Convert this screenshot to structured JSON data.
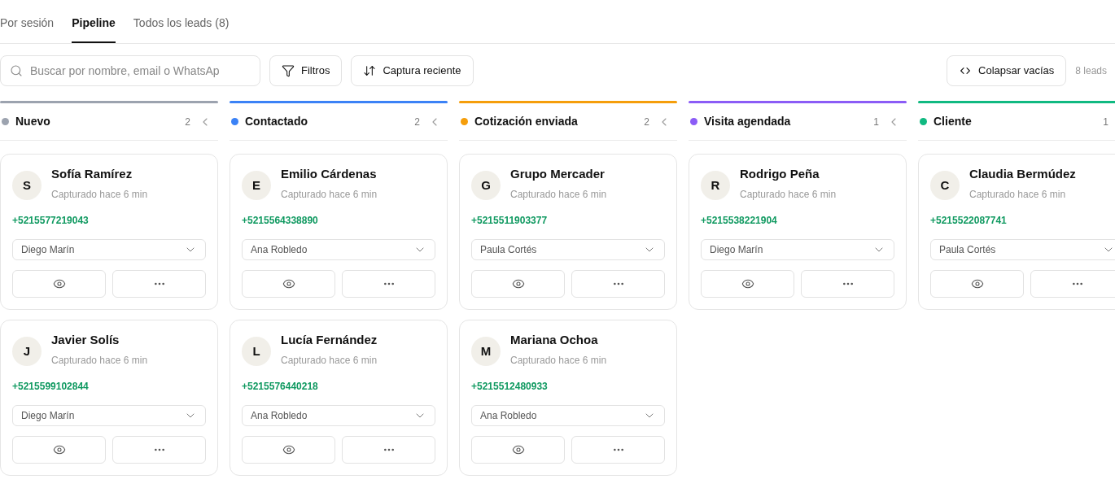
{
  "tabs": [
    {
      "label": "Por sesión",
      "selected": false
    },
    {
      "label": "Pipeline",
      "selected": true
    },
    {
      "label": "Todos los leads (8)",
      "selected": false
    }
  ],
  "search": {
    "placeholder": "Buscar por nombre, email o WhatsAp"
  },
  "toolbar": {
    "filters": "Filtros",
    "sort": "Captura reciente",
    "collapse": "Colapsar vacías",
    "total": "8 leads"
  },
  "columns": [
    {
      "name": "Nuevo",
      "color": "#9ca3af",
      "count": "2",
      "leads": [
        {
          "initial": "S",
          "name": "Sofía Ramírez",
          "captured": "Capturado hace 6 min",
          "phone": "+5215577219043",
          "agent": "Diego Marín"
        },
        {
          "initial": "J",
          "name": "Javier Solís",
          "captured": "Capturado hace 6 min",
          "phone": "+5215599102844",
          "agent": "Diego Marín"
        }
      ]
    },
    {
      "name": "Contactado",
      "color": "#3b82f6",
      "count": "2",
      "leads": [
        {
          "initial": "E",
          "name": "Emilio Cárdenas",
          "captured": "Capturado hace 6 min",
          "phone": "+5215564338890",
          "agent": "Ana Robledo"
        },
        {
          "initial": "L",
          "name": "Lucía Fernández",
          "captured": "Capturado hace 6 min",
          "phone": "+5215576440218",
          "agent": "Ana Robledo"
        }
      ]
    },
    {
      "name": "Cotización enviada",
      "color": "#f59e0b",
      "count": "2",
      "leads": [
        {
          "initial": "G",
          "name": "Grupo Mercader",
          "captured": "Capturado hace 6 min",
          "phone": "+5215511903377",
          "agent": "Paula Cortés"
        },
        {
          "initial": "M",
          "name": "Mariana Ochoa",
          "captured": "Capturado hace 6 min",
          "phone": "+5215512480933",
          "agent": "Ana Robledo"
        }
      ]
    },
    {
      "name": "Visita agendada",
      "color": "#8b5cf6",
      "count": "1",
      "leads": [
        {
          "initial": "R",
          "name": "Rodrigo Peña",
          "captured": "Capturado hace 6 min",
          "phone": "+5215538221904",
          "agent": "Diego Marín"
        }
      ]
    },
    {
      "name": "Cliente",
      "color": "#10b981",
      "count": "1",
      "leads": [
        {
          "initial": "C",
          "name": "Claudia Bermúdez",
          "captured": "Capturado hace 6 min",
          "phone": "+5215522087741",
          "agent": "Paula Cortés"
        }
      ]
    }
  ]
}
